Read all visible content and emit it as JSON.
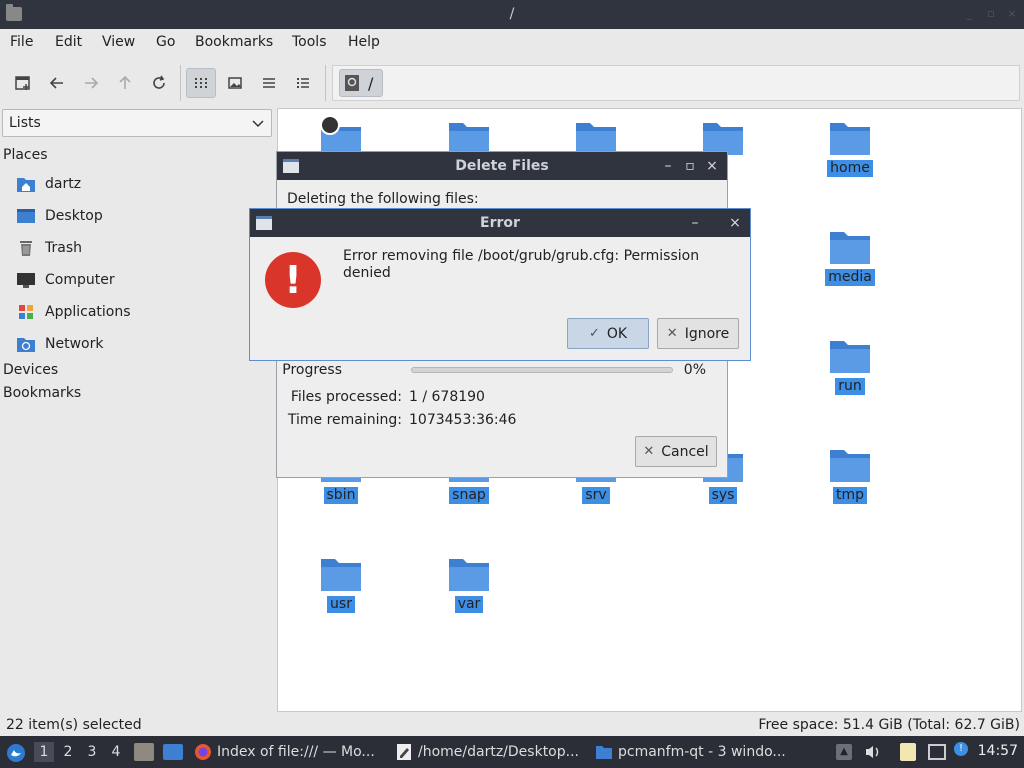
{
  "window": {
    "title": "/",
    "controls": [
      "_",
      "▫",
      "×"
    ]
  },
  "menu": [
    "File",
    "Edit",
    "View",
    "Go",
    "Bookmarks",
    "Tools",
    "Help"
  ],
  "path": {
    "value": "/"
  },
  "side": {
    "combo_value": "Lists",
    "places_header": "Places",
    "places": [
      {
        "label": "dartz",
        "icon": "home-folder-icon"
      },
      {
        "label": "Desktop",
        "icon": "desktop-icon"
      },
      {
        "label": "Trash",
        "icon": "trash-icon"
      },
      {
        "label": "Computer",
        "icon": "computer-icon"
      },
      {
        "label": "Applications",
        "icon": "applications-icon"
      },
      {
        "label": "Network",
        "icon": "network-icon"
      }
    ],
    "devices_header": "Devices",
    "bookmarks_header": "Bookmarks"
  },
  "files": [
    "home",
    "media",
    "run",
    "sbin",
    "snap",
    "srv",
    "sys",
    "tmp",
    "usr",
    "var"
  ],
  "status": {
    "selected": "22 item(s) selected",
    "free_space": "Free space: 51.4 GiB (Total: 62.7 GiB)"
  },
  "taskbar": {
    "workspaces": [
      "1",
      "2",
      "3",
      "4"
    ],
    "tasks": [
      "Index of file:/// — Mo...",
      "/home/dartz/Desktop...",
      "pcmanfm-qt - 3 windo..."
    ],
    "clock": "14:57"
  },
  "delete_dialog": {
    "title": "Delete Files",
    "heading": "Deleting the following files:",
    "progress_label": "Progress",
    "progress_value": "0%",
    "progress_fraction": 0.0,
    "files_processed_label": "Files processed:",
    "files_processed_value": "1 / 678190",
    "time_remaining_label": "Time remaining:",
    "time_remaining_value": "1073453:36:46",
    "cancel_label": "Cancel"
  },
  "error_dialog": {
    "title": "Error",
    "message": "Error removing file /boot/grub/grub.cfg: Permission denied",
    "ok_label": "OK",
    "ignore_label": "Ignore"
  },
  "colors": {
    "accent": "#3d8ee5",
    "titlebar": "#2f343f",
    "error_red": "#d9352b"
  }
}
